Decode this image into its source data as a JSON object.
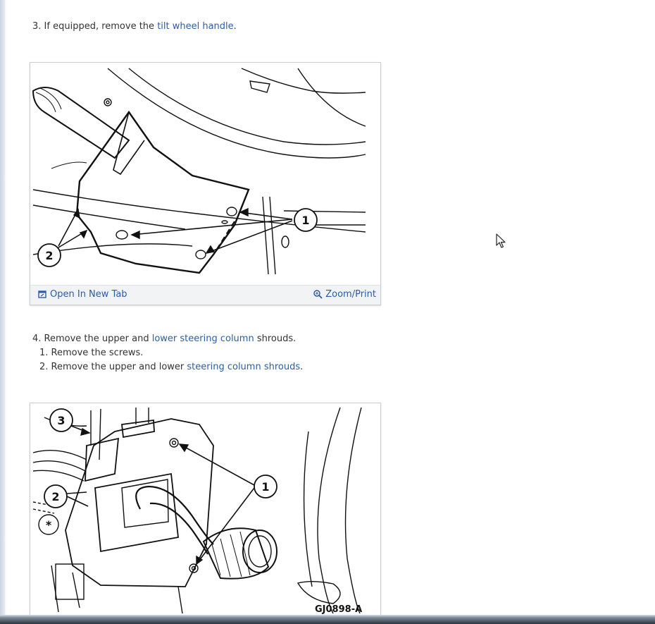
{
  "steps": [
    {
      "number": "3.",
      "text_before": "If equipped, remove the",
      "link": "tilt wheel handle",
      "text_after": "."
    },
    {
      "number": "4.",
      "text_before": "Remove the upper and",
      "link": "lower steering column",
      "text_after": "shrouds.",
      "substeps": [
        {
          "number": "1.",
          "text": "Remove the screws."
        },
        {
          "number": "2.",
          "text_before": "Remove the upper and lower",
          "link": "steering column shrouds",
          "text_after": "."
        }
      ]
    }
  ],
  "figure1": {
    "callouts": [
      "1",
      "2"
    ],
    "open_label": "Open In New Tab",
    "zoom_label": "Zoom/Print",
    "open_icon": "open-in-new-tab-icon",
    "zoom_icon": "magnifier-icon"
  },
  "figure2": {
    "callouts": [
      "3",
      "2",
      "1"
    ],
    "code": "GJ0898-A"
  },
  "colors": {
    "link": "#2a5da8",
    "footer_bg": "#f1f3f5",
    "border": "#c8cdd3"
  }
}
